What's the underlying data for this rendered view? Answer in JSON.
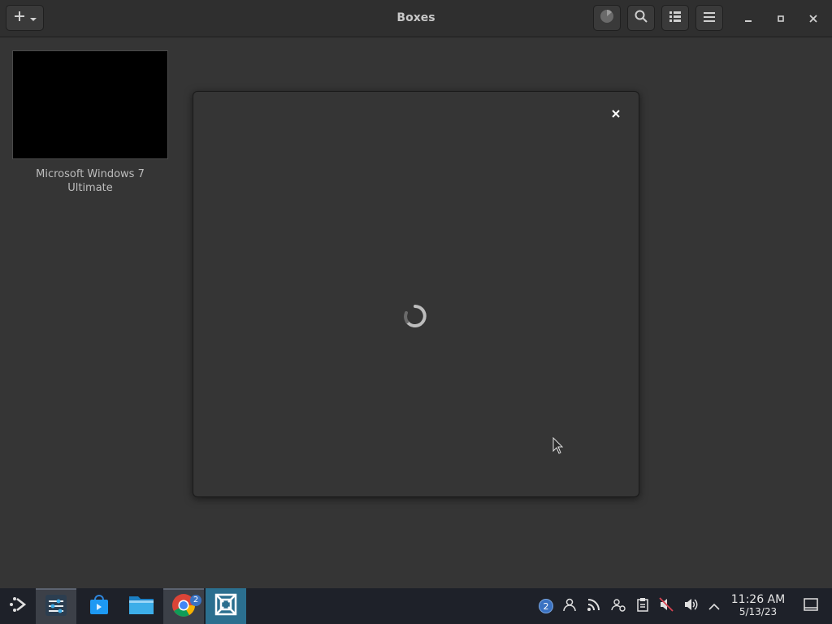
{
  "window": {
    "title": "Boxes",
    "new_button_icon": "plus-icon",
    "toolbar": [
      {
        "name": "activity-icon"
      },
      {
        "name": "search-icon"
      },
      {
        "name": "list-view-icon"
      },
      {
        "name": "menu-icon"
      }
    ],
    "controls": [
      "minimize",
      "maximize",
      "close"
    ]
  },
  "machines": [
    {
      "name": "Microsoft Windows 7 Ultimate",
      "line1": "Microsoft Windows 7",
      "line2": "Ultimate"
    }
  ],
  "dialog": {
    "state": "loading",
    "close_icon": "close-icon"
  },
  "taskbar": {
    "apps": [
      {
        "name": "app-launcher-icon"
      },
      {
        "name": "system-settings-icon"
      },
      {
        "name": "discover-store-icon"
      },
      {
        "name": "file-manager-icon"
      },
      {
        "name": "chrome-icon",
        "badge": "2"
      },
      {
        "name": "boxes-icon"
      }
    ],
    "tray": {
      "notifications_badge": "2",
      "icons": [
        "user-icon",
        "feed-icon",
        "user-switch-icon",
        "clipboard-icon",
        "audio-muted-icon",
        "volume-icon",
        "expand-tray-icon"
      ]
    },
    "clock": {
      "time": "11:26 AM",
      "date": "5/13/23"
    }
  },
  "colors": {
    "background": "#353535",
    "headerbar": "#2f2f2f",
    "taskbar": "#1e2129",
    "active_app": "#2b6f8f"
  }
}
